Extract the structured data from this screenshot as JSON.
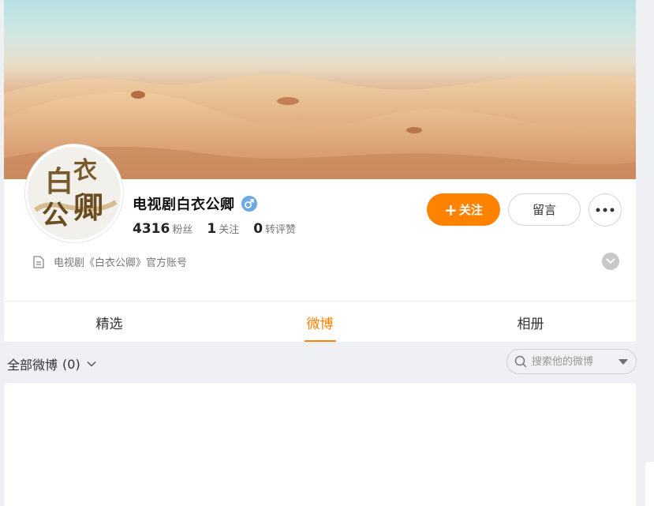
{
  "profile": {
    "name": "电视剧白衣公卿",
    "gender_icon": "male-icon",
    "avatar_text": "白衣公卿",
    "description": "电视剧《白衣公卿》官方账号",
    "stats": [
      {
        "value": "4316",
        "label": "粉丝"
      },
      {
        "value": "1",
        "label": "关注"
      },
      {
        "value": "0",
        "label": "转评赞"
      }
    ]
  },
  "actions": {
    "follow_label": "关注",
    "message_label": "留言",
    "more_icon": "more-icon"
  },
  "tabs": [
    {
      "label": "精选",
      "active": false
    },
    {
      "label": "微博",
      "active": true
    },
    {
      "label": "相册",
      "active": false
    }
  ],
  "filter": {
    "label": "全部微博",
    "count": "(0)"
  },
  "search": {
    "placeholder": "搜索他的微博"
  },
  "colors": {
    "accent": "#ff8200",
    "gender_badge": "#6aa8e8",
    "page_bg": "#eff0f4"
  }
}
